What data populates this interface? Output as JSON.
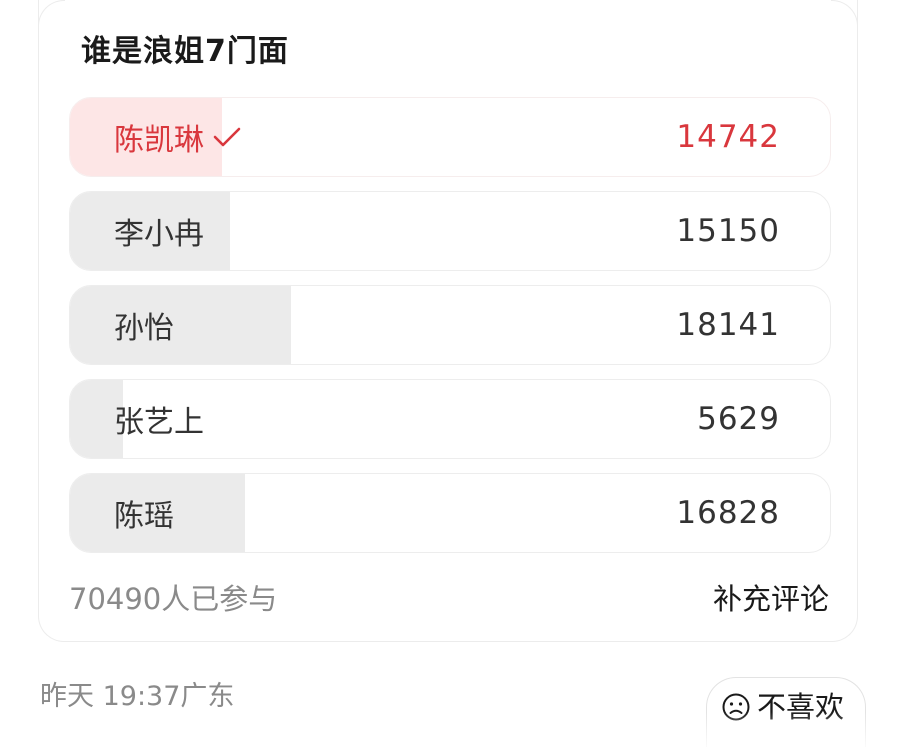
{
  "poll": {
    "title": "谁是浪姐7门面",
    "options": [
      {
        "label": "陈凯琳",
        "count": "14742",
        "selected": true
      },
      {
        "label": "李小冉",
        "count": "15150",
        "selected": false
      },
      {
        "label": "孙怡",
        "count": "18141",
        "selected": false
      },
      {
        "label": "张艺上",
        "count": "5629",
        "selected": false
      },
      {
        "label": "陈瑶",
        "count": "16828",
        "selected": false
      }
    ],
    "participants": "70490人已参与",
    "add_comment_label": "补充评论"
  },
  "meta": {
    "time_location": "昨天 19:37广东"
  },
  "actions": {
    "dislike_label": "不喜欢"
  },
  "colors": {
    "accent": "#d9373d",
    "selected_fill": "#fde6e6",
    "bar_fill": "#ebebeb"
  },
  "icons": {
    "selected_check": "check-icon",
    "dislike": "sad-face-icon"
  }
}
